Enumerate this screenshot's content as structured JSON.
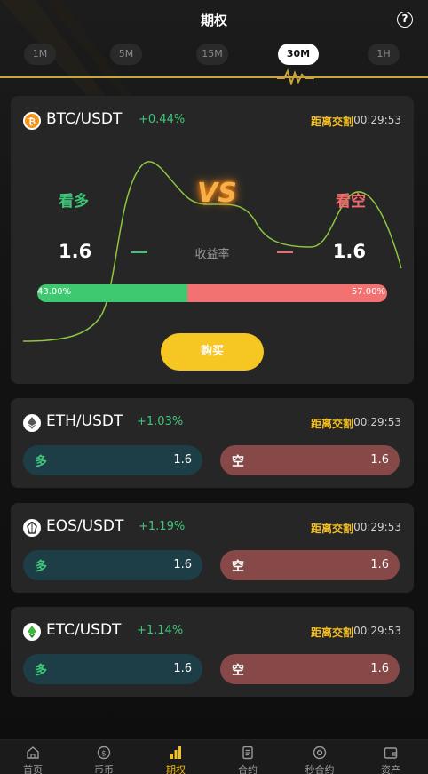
{
  "header": {
    "title": "期权",
    "help_glyph": "?"
  },
  "periods": [
    "1M",
    "5M",
    "15M",
    "30M",
    "1H"
  ],
  "active_period": "30M",
  "main": {
    "pair": "BTC/USDT",
    "change": "+0.44%",
    "countdown_label": "距离交割",
    "countdown": "00:29:53",
    "long_label": "看多",
    "short_label": "看空",
    "vs": "VS",
    "long_rate": "1.6",
    "short_rate": "1.6",
    "rate_label": "收益率",
    "long_percent_text": "43.00%",
    "short_percent_text": "57.00%",
    "long_ratio": 0.43,
    "buy_label": "购买",
    "coin_icon": "bitcoin-icon"
  },
  "contracts": [
    {
      "pair": "ETH/USDT",
      "change": "+1.03%",
      "countdown_label": "距离交割",
      "countdown": "00:29:53",
      "long_label": "多",
      "long_value": "1.6",
      "short_label": "空",
      "short_value": "1.6",
      "icon": "ethereum-icon"
    },
    {
      "pair": "EOS/USDT",
      "change": "+1.19%",
      "countdown_label": "距离交割",
      "countdown": "00:29:53",
      "long_label": "多",
      "long_value": "1.6",
      "short_label": "空",
      "short_value": "1.6",
      "icon": "eos-icon"
    },
    {
      "pair": "ETC/USDT",
      "change": "+1.14%",
      "countdown_label": "距离交割",
      "countdown": "00:29:53",
      "long_label": "多",
      "long_value": "1.6",
      "short_label": "空",
      "short_value": "1.6",
      "icon": "ethereum-classic-icon"
    }
  ],
  "tabs": [
    {
      "label": "首页",
      "icon": "home-icon"
    },
    {
      "label": "币币",
      "icon": "dollar-coin-icon"
    },
    {
      "label": "期权",
      "icon": "bar-chart-icon"
    },
    {
      "label": "合约",
      "icon": "document-icon"
    },
    {
      "label": "秒合约",
      "icon": "target-icon"
    },
    {
      "label": "资产",
      "icon": "wallet-icon"
    }
  ],
  "active_tab": "期权",
  "colors": {
    "accent_gold": "#f4c01e",
    "up_green": "#3fc57a",
    "down_red": "#f06b6b",
    "card_bg": "#262626"
  }
}
